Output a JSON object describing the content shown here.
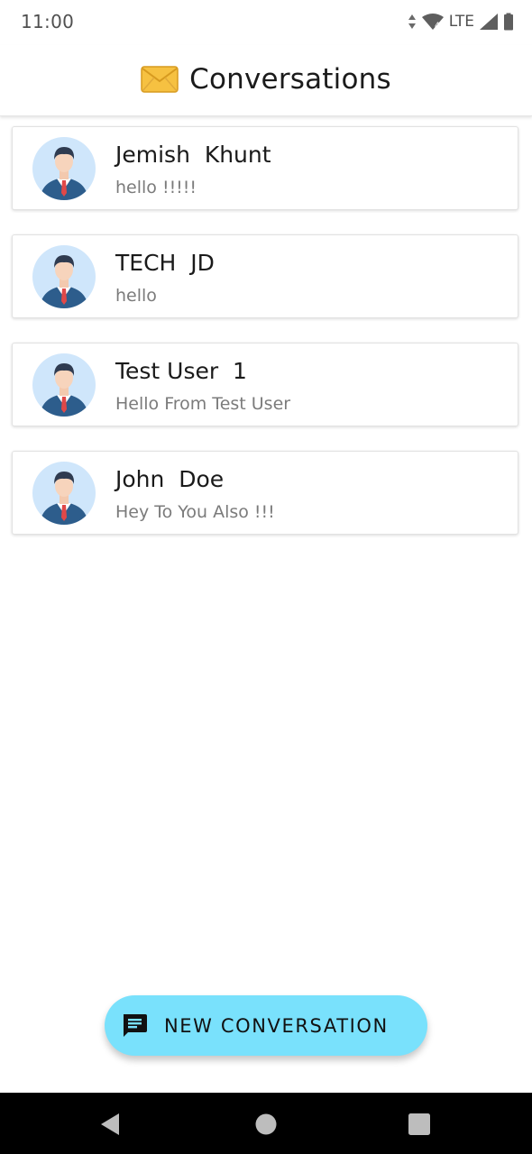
{
  "status_bar": {
    "time": "11:00",
    "network": "LTE",
    "icons": [
      "data-arrows-icon",
      "wifi-icon",
      "signal-icon",
      "battery-icon"
    ]
  },
  "header": {
    "icon": "envelope-icon",
    "title": "Conversations"
  },
  "conversations": [
    {
      "name": "Jemish  Khunt",
      "preview": "hello !!!!!",
      "avatar": "user-avatar-icon"
    },
    {
      "name": "TECH  JD",
      "preview": "hello",
      "avatar": "user-avatar-icon"
    },
    {
      "name": "Test User  1",
      "preview": "Hello From Test User",
      "avatar": "user-avatar-icon"
    },
    {
      "name": "John  Doe",
      "preview": "Hey To You Also !!!",
      "avatar": "user-avatar-icon"
    }
  ],
  "fab": {
    "icon": "chat-icon",
    "label": "NEW CONVERSATION",
    "color": "#79e1fc"
  },
  "nav_bar": {
    "buttons": [
      "back-icon",
      "home-icon",
      "recents-icon"
    ]
  },
  "colors": {
    "background": "#ffffff",
    "accent": "#79e1fc",
    "avatar_bg": "#cfe6fb",
    "suit": "#2d5d8c",
    "tie": "#e04848"
  }
}
